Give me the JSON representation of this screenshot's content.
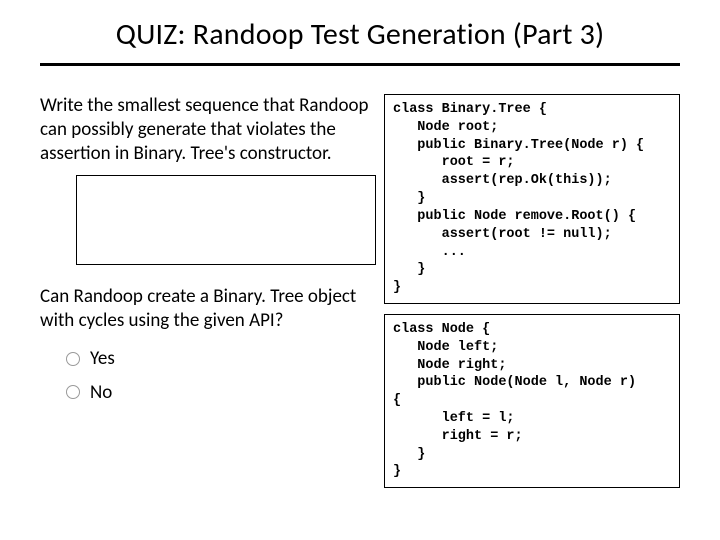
{
  "title": "QUIZ: Randoop Test Generation (Part 3)",
  "left": {
    "prompt1": "Write the smallest sequence that Randoop can possibly generate that violates the assertion in Binary. Tree's constructor.",
    "prompt2": "Can Randoop create a Binary. Tree object with cycles using the given API?",
    "options": {
      "yes": "Yes",
      "no": "No"
    }
  },
  "code": {
    "tree": "class Binary.Tree {\n   Node root;\n   public Binary.Tree(Node r) {\n      root = r;\n      assert(rep.Ok(this));\n   }\n   public Node remove.Root() {\n      assert(root != null);\n      ...\n   }\n}",
    "node": "class Node {\n   Node left;\n   Node right;\n   public Node(Node l, Node r)\n{\n      left = l;\n      right = r;\n   }\n}"
  }
}
